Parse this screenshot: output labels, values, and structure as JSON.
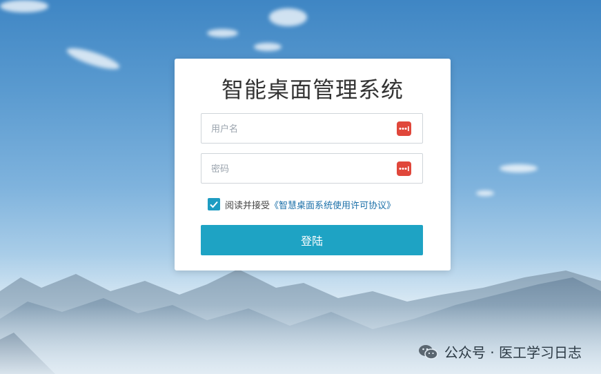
{
  "app": {
    "title": "智能桌面管理系统"
  },
  "form": {
    "username_placeholder": "用户名",
    "password_placeholder": "密码",
    "username_icon": "password-key-icon",
    "password_icon": "password-key-icon",
    "agree_checked": true,
    "agree_text": "阅读并接受",
    "agree_link": "《智慧桌面系统使用许可协议》",
    "login_label": "登陆"
  },
  "watermark": {
    "text": "公众号 · 医工学习日志",
    "icon": "wechat-icon"
  },
  "colors": {
    "primary_button": "#1ea3c4",
    "checkbox": "#1e9cc2",
    "link": "#1a6fa8",
    "key_icon": "#e0473b"
  }
}
